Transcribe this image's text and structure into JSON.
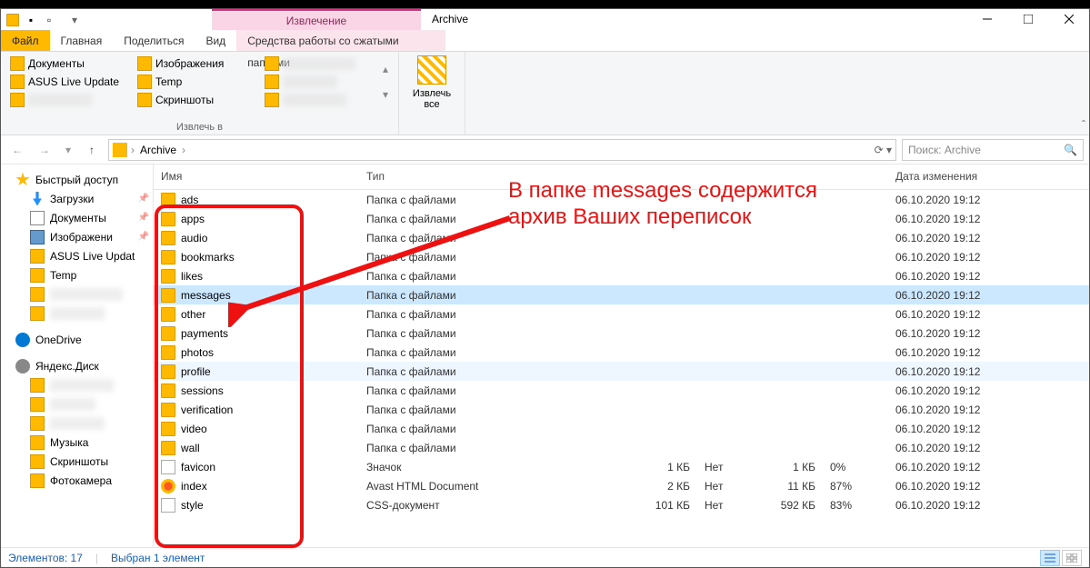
{
  "title": "Archive",
  "contextual_tab": "Извлечение",
  "ribbon_tabs": {
    "file": "Файл",
    "home": "Главная",
    "share": "Поделиться",
    "view": "Вид",
    "ctx": "Средства работы со сжатыми папками"
  },
  "ribbon": {
    "pin1": "Документы",
    "pin2": "ASUS Live Update",
    "pin3": "Изображения",
    "pin4": "Temp",
    "pin5": "Скриншоты",
    "group_extract": "Извлечь в",
    "extract_all": "Извлечь\nвсе"
  },
  "address": {
    "root": "Archive"
  },
  "search_placeholder": "Поиск: Archive",
  "sidebar": {
    "quick": "Быстрый доступ",
    "downloads": "Загрузки",
    "documents": "Документы",
    "pictures": "Изображени",
    "asus": "ASUS Live Updat",
    "temp": "Temp",
    "onedrive": "OneDrive",
    "yandex": "Яндекс.Диск",
    "music": "Музыка",
    "screenshots": "Скриншоты",
    "camera": "Фотокамера"
  },
  "columns": {
    "name": "Имя",
    "type": "Тип",
    "date": "Дата изменения"
  },
  "rows": [
    {
      "name": "ads",
      "type": "Папка с файлами",
      "date": "06.10.2020 19:12",
      "kind": "folder"
    },
    {
      "name": "apps",
      "type": "Папка с файлами",
      "date": "06.10.2020 19:12",
      "kind": "folder"
    },
    {
      "name": "audio",
      "type": "Папка с файлами",
      "date": "06.10.2020 19:12",
      "kind": "folder"
    },
    {
      "name": "bookmarks",
      "type": "Папка с файлами",
      "date": "06.10.2020 19:12",
      "kind": "folder"
    },
    {
      "name": "likes",
      "type": "Папка с файлами",
      "date": "06.10.2020 19:12",
      "kind": "folder"
    },
    {
      "name": "messages",
      "type": "Папка с файлами",
      "date": "06.10.2020 19:12",
      "kind": "folder",
      "sel": true
    },
    {
      "name": "other",
      "type": "Папка с файлами",
      "date": "06.10.2020 19:12",
      "kind": "folder"
    },
    {
      "name": "payments",
      "type": "Папка с файлами",
      "date": "06.10.2020 19:12",
      "kind": "folder"
    },
    {
      "name": "photos",
      "type": "Папка с файлами",
      "date": "06.10.2020 19:12",
      "kind": "folder"
    },
    {
      "name": "profile",
      "type": "Папка с файлами",
      "date": "06.10.2020 19:12",
      "kind": "folder",
      "faint": true
    },
    {
      "name": "sessions",
      "type": "Папка с файлами",
      "date": "06.10.2020 19:12",
      "kind": "folder"
    },
    {
      "name": "verification",
      "type": "Папка с файлами",
      "date": "06.10.2020 19:12",
      "kind": "folder"
    },
    {
      "name": "video",
      "type": "Папка с файлами",
      "date": "06.10.2020 19:12",
      "kind": "folder"
    },
    {
      "name": "wall",
      "type": "Папка с файлами",
      "date": "06.10.2020 19:12",
      "kind": "folder"
    },
    {
      "name": "favicon",
      "type": "Значок",
      "szc": "1 КБ",
      "szd": "Нет",
      "szd2": "1 КБ",
      "ratio": "0%",
      "date": "06.10.2020 19:12",
      "kind": "file"
    },
    {
      "name": "index",
      "type": "Avast HTML Document",
      "szc": "2 КБ",
      "szd": "Нет",
      "szd2": "11 КБ",
      "ratio": "87%",
      "date": "06.10.2020 19:12",
      "kind": "html"
    },
    {
      "name": "style",
      "type": "CSS-документ",
      "szc": "101 КБ",
      "szd": "Нет",
      "szd2": "592 КБ",
      "ratio": "83%",
      "date": "06.10.2020 19:12",
      "kind": "css"
    }
  ],
  "status": {
    "count": "Элементов: 17",
    "selected": "Выбран 1 элемент"
  },
  "annotation": "В папке messages содержится\nархив Ваших переписок"
}
